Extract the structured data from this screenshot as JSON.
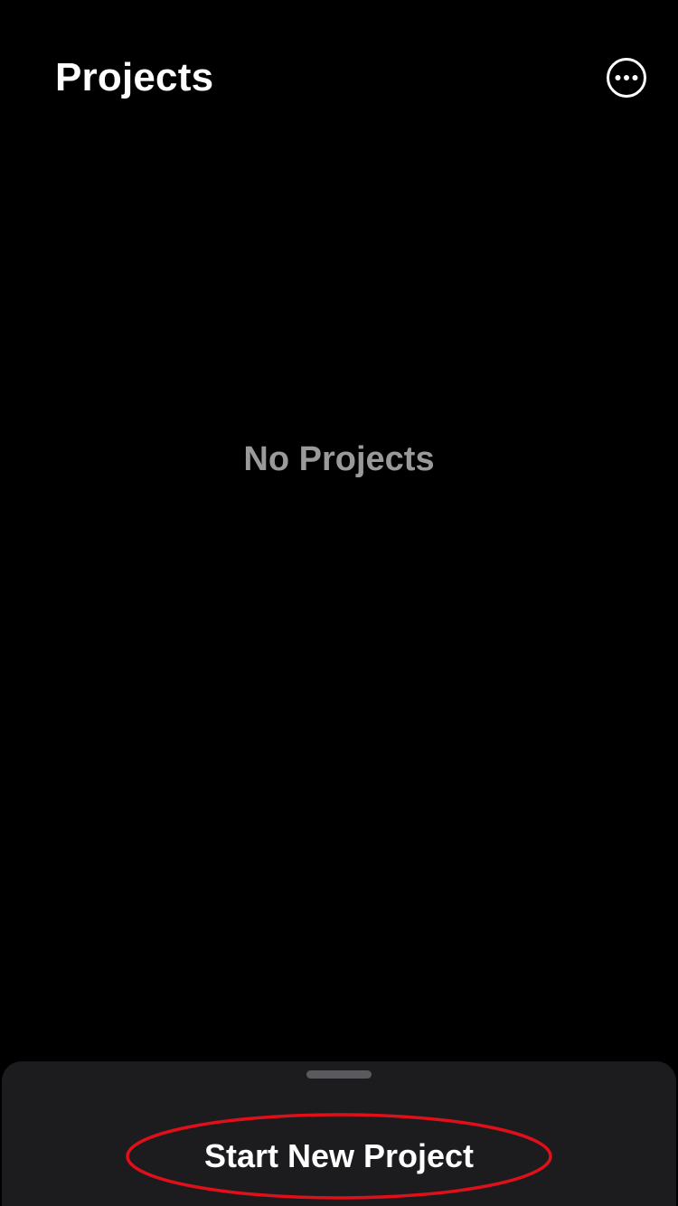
{
  "header": {
    "title": "Projects",
    "more_icon": "ellipsis-circle-icon"
  },
  "main": {
    "empty_state": "No Projects"
  },
  "bottom_sheet": {
    "primary_action": "Start New Project"
  },
  "colors": {
    "background": "#000000",
    "sheet": "#1c1c1e",
    "primary_text": "#ffffff",
    "secondary_text": "#9a9a9a",
    "annotation": "#e0101a"
  }
}
